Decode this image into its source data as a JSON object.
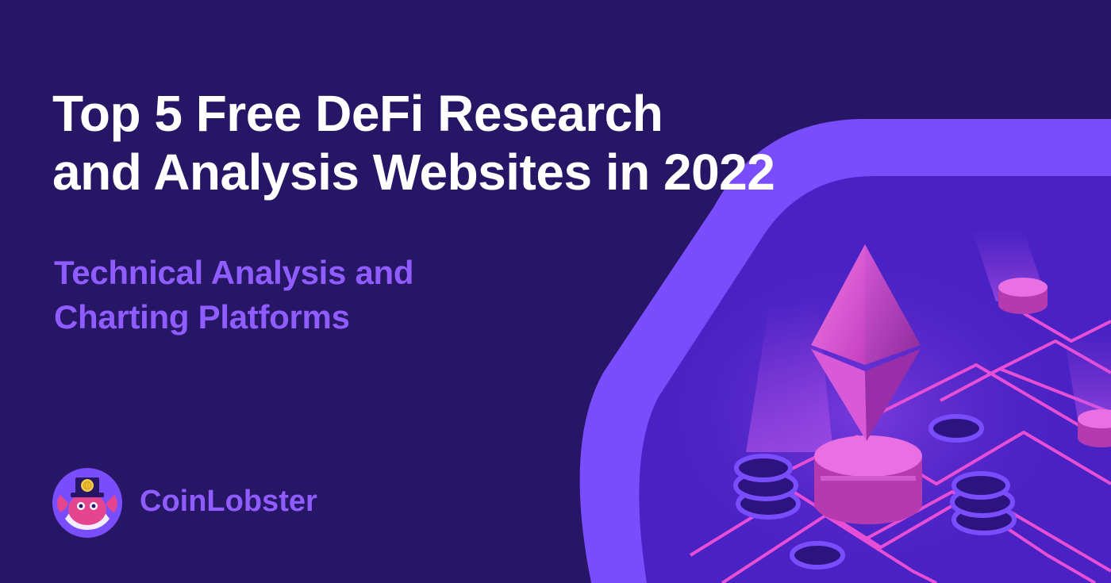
{
  "headline": {
    "line1": "Top 5 Free DeFi Research",
    "line2": "and Analysis Websites in 2022"
  },
  "subheadline": {
    "line1": "Technical Analysis and",
    "line2": "Charting Platforms"
  },
  "brand": {
    "name": "CoinLobster",
    "logo_icon": "lobster-mascot-icon"
  },
  "colors": {
    "background": "#271566",
    "accent_purple": "#8e5cff",
    "magenta": "#e94fd6",
    "title_text": "#ffffff"
  },
  "illustration": {
    "subject": "ethereum-diamond-on-defi-circuit-board",
    "icons": [
      "ethereum-icon",
      "coin-stack-icon",
      "pedestal-icon",
      "circuit-line-icon"
    ]
  }
}
